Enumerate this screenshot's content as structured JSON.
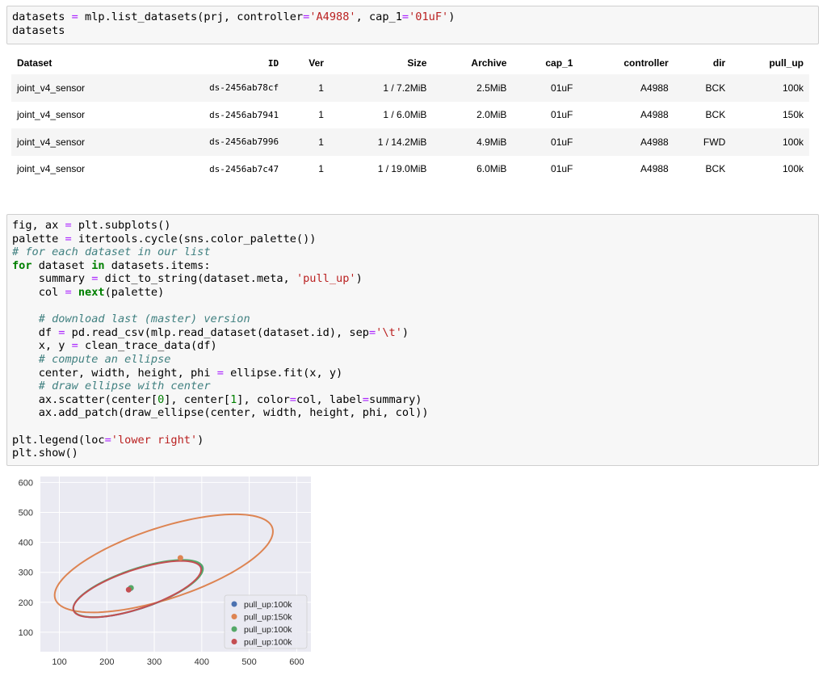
{
  "cell1": {
    "line1": [
      {
        "t": "datasets ",
        "c": ""
      },
      {
        "t": "=",
        "c": "op"
      },
      {
        "t": " mlp.list_datasets(prj, controller",
        "c": ""
      },
      {
        "t": "=",
        "c": "op"
      },
      {
        "t": "'A4988'",
        "c": "str"
      },
      {
        "t": ", cap_1",
        "c": ""
      },
      {
        "t": "=",
        "c": "op"
      },
      {
        "t": "'01uF'",
        "c": "str"
      },
      {
        "t": ")",
        "c": ""
      }
    ],
    "line2": "datasets"
  },
  "table": {
    "headers": [
      "Dataset",
      "ID",
      "Ver",
      "Size",
      "Archive",
      "cap_1",
      "controller",
      "dir",
      "pull_up"
    ],
    "rows": [
      [
        "joint_v4_sensor",
        "ds-2456ab78cf",
        "1",
        "1 / 7.2MiB",
        "2.5MiB",
        "01uF",
        "A4988",
        "BCK",
        "100k"
      ],
      [
        "joint_v4_sensor",
        "ds-2456ab7941",
        "1",
        "1 / 6.0MiB",
        "2.0MiB",
        "01uF",
        "A4988",
        "BCK",
        "150k"
      ],
      [
        "joint_v4_sensor",
        "ds-2456ab7996",
        "1",
        "1 / 14.2MiB",
        "4.9MiB",
        "01uF",
        "A4988",
        "FWD",
        "100k"
      ],
      [
        "joint_v4_sensor",
        "ds-2456ab7c47",
        "1",
        "1 / 19.0MiB",
        "6.0MiB",
        "01uF",
        "A4988",
        "BCK",
        "100k"
      ]
    ]
  },
  "cell2": {
    "lines": [
      [
        {
          "t": "fig, ax ",
          "c": ""
        },
        {
          "t": "=",
          "c": "op"
        },
        {
          "t": " plt.subplots()",
          "c": ""
        }
      ],
      [
        {
          "t": "palette ",
          "c": ""
        },
        {
          "t": "=",
          "c": "op"
        },
        {
          "t": " itertools.cycle(sns.color_palette())",
          "c": ""
        }
      ],
      [
        {
          "t": "# for each dataset in our list",
          "c": "cm"
        }
      ],
      [
        {
          "t": "for",
          "c": "kw"
        },
        {
          "t": " dataset ",
          "c": ""
        },
        {
          "t": "in",
          "c": "kw"
        },
        {
          "t": " datasets.items:",
          "c": ""
        }
      ],
      [
        {
          "t": "    summary ",
          "c": ""
        },
        {
          "t": "=",
          "c": "op"
        },
        {
          "t": " dict_to_string(dataset.meta, ",
          "c": ""
        },
        {
          "t": "'pull_up'",
          "c": "str"
        },
        {
          "t": ")",
          "c": ""
        }
      ],
      [
        {
          "t": "    col ",
          "c": ""
        },
        {
          "t": "=",
          "c": "op"
        },
        {
          "t": " ",
          "c": ""
        },
        {
          "t": "next",
          "c": "kw2"
        },
        {
          "t": "(palette)",
          "c": ""
        }
      ],
      [
        {
          "t": "",
          "c": ""
        }
      ],
      [
        {
          "t": "    ",
          "c": ""
        },
        {
          "t": "# download last (master) version",
          "c": "cm"
        }
      ],
      [
        {
          "t": "    df ",
          "c": ""
        },
        {
          "t": "=",
          "c": "op"
        },
        {
          "t": " pd.read_csv(mlp.read_dataset(dataset.id), sep",
          "c": ""
        },
        {
          "t": "=",
          "c": "op"
        },
        {
          "t": "'\\t'",
          "c": "str"
        },
        {
          "t": ")",
          "c": ""
        }
      ],
      [
        {
          "t": "    x, y ",
          "c": ""
        },
        {
          "t": "=",
          "c": "op"
        },
        {
          "t": " clean_trace_data(df)",
          "c": ""
        }
      ],
      [
        {
          "t": "    ",
          "c": ""
        },
        {
          "t": "# compute an ellipse",
          "c": "cm"
        }
      ],
      [
        {
          "t": "    center, width, height, phi ",
          "c": ""
        },
        {
          "t": "=",
          "c": "op"
        },
        {
          "t": " ellipse.fit(x, y)",
          "c": ""
        }
      ],
      [
        {
          "t": "    ",
          "c": ""
        },
        {
          "t": "# draw ellipse with center",
          "c": "cm"
        }
      ],
      [
        {
          "t": "    ax.scatter(center[",
          "c": ""
        },
        {
          "t": "0",
          "c": "num"
        },
        {
          "t": "], center[",
          "c": ""
        },
        {
          "t": "1",
          "c": "num"
        },
        {
          "t": "], color",
          "c": ""
        },
        {
          "t": "=",
          "c": "op"
        },
        {
          "t": "col, label",
          "c": ""
        },
        {
          "t": "=",
          "c": "op"
        },
        {
          "t": "summary)",
          "c": ""
        }
      ],
      [
        {
          "t": "    ax.add_patch(draw_ellipse(center, width, height, phi, col))",
          "c": ""
        }
      ],
      [
        {
          "t": "",
          "c": ""
        }
      ],
      [
        {
          "t": "plt.legend(loc",
          "c": ""
        },
        {
          "t": "=",
          "c": "op"
        },
        {
          "t": "'lower right'",
          "c": "str"
        },
        {
          "t": ")",
          "c": ""
        }
      ],
      [
        {
          "t": "plt.show()",
          "c": ""
        }
      ]
    ]
  },
  "chart_data": {
    "type": "scatter",
    "xlim": [
      60,
      630
    ],
    "ylim": [
      35,
      620
    ],
    "xticks": [
      "100",
      "200",
      "300",
      "400",
      "500",
      "600"
    ],
    "yticks": [
      "100",
      "200",
      "300",
      "400",
      "500",
      "600"
    ],
    "grid": true,
    "legend_position": "lower right",
    "background": "#eaeaf2",
    "series": [
      {
        "name": "pull_up:100k",
        "color": "#4c72b0",
        "center": [
          250,
          247
        ],
        "ellipse": {
          "cx": 265,
          "cy": 245,
          "rx": 154,
          "ry": 61,
          "angle_deg": 31
        }
      },
      {
        "name": "pull_up:150k",
        "color": "#dd8452",
        "center": [
          355,
          348
        ],
        "ellipse": {
          "cx": 320,
          "cy": 330,
          "rx": 260,
          "ry": 110,
          "angle_deg": 31
        }
      },
      {
        "name": "pull_up:100k",
        "color": "#55a868",
        "center": [
          251,
          248
        ],
        "ellipse": {
          "cx": 266,
          "cy": 246,
          "rx": 155,
          "ry": 61,
          "angle_deg": 31
        }
      },
      {
        "name": "pull_up:100k",
        "color": "#c44e52",
        "center": [
          246,
          242
        ],
        "ellipse": {
          "cx": 264,
          "cy": 244,
          "rx": 153,
          "ry": 60,
          "angle_deg": 31
        }
      }
    ]
  }
}
